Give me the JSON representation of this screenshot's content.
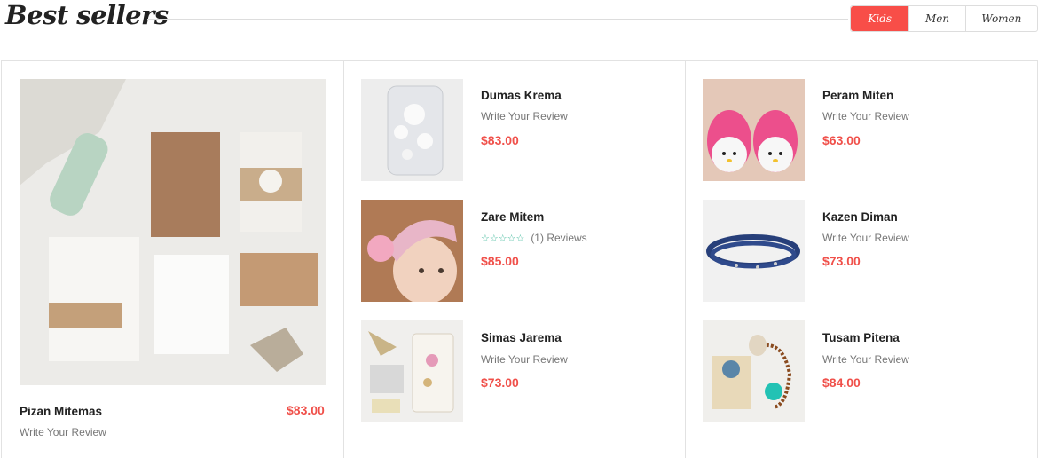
{
  "header": {
    "title": "Best sellers",
    "tabs": [
      {
        "label": "Kids",
        "active": true
      },
      {
        "label": "Men",
        "active": false
      },
      {
        "label": "Women",
        "active": false
      }
    ]
  },
  "colors": {
    "accent": "#f84e48",
    "price": "#f0504a",
    "star": "#3fb89a"
  },
  "featured": {
    "name": "Pizan Mitemas",
    "price": "$83.00",
    "review": "Write Your Review",
    "image_icon": "wedding-stationery-image"
  },
  "columns": [
    {
      "products": [
        {
          "name": "Dumas Krema",
          "review": "Write Your Review",
          "price": "$83.00",
          "image_icon": "jeweled-phone-case-image"
        },
        {
          "name": "Zare Mitem",
          "stars": "☆☆☆☆☆",
          "reviews_count": "(1) Reviews",
          "price": "$85.00",
          "image_icon": "baby-headband-image"
        },
        {
          "name": "Simas Jarema",
          "review": "Write Your Review",
          "price": "$73.00",
          "image_icon": "jeweled-phone-wallet-image"
        }
      ]
    },
    {
      "products": [
        {
          "name": "Peram Miten",
          "review": "Write Your Review",
          "price": "$63.00",
          "image_icon": "crochet-baby-shoes-image"
        },
        {
          "name": "Kazen Diman",
          "review": "Write Your Review",
          "price": "$73.00",
          "image_icon": "beaded-bracelet-image"
        },
        {
          "name": "Tusam Pitena",
          "review": "Write Your Review",
          "price": "$84.00",
          "image_icon": "teething-necklace-image"
        }
      ]
    }
  ]
}
